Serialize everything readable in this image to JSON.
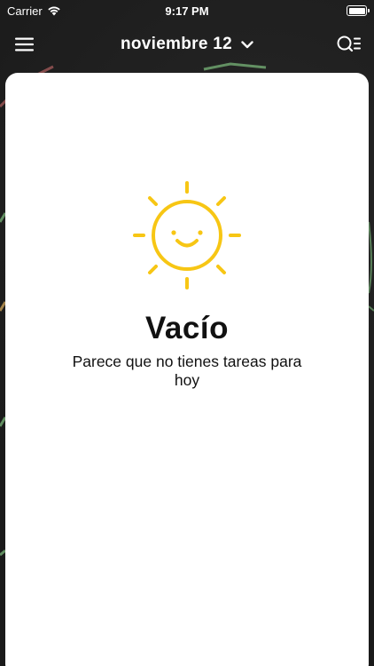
{
  "status_bar": {
    "carrier": "Carrier",
    "time": "9:17 PM"
  },
  "nav": {
    "date_label": "noviembre 12",
    "menu_icon": "hamburger-menu-icon",
    "dropdown_icon": "chevron-down-icon",
    "search_icon": "search-list-icon"
  },
  "empty_state": {
    "illustration": "smiling-sun-icon",
    "title": "Vacío",
    "message": "Parece que no tienes tareas para hoy"
  },
  "colors": {
    "accent_yellow": "#F7C614",
    "nav_background": "#1b1b1b",
    "card_background": "#ffffff",
    "text_dark": "#111111"
  }
}
